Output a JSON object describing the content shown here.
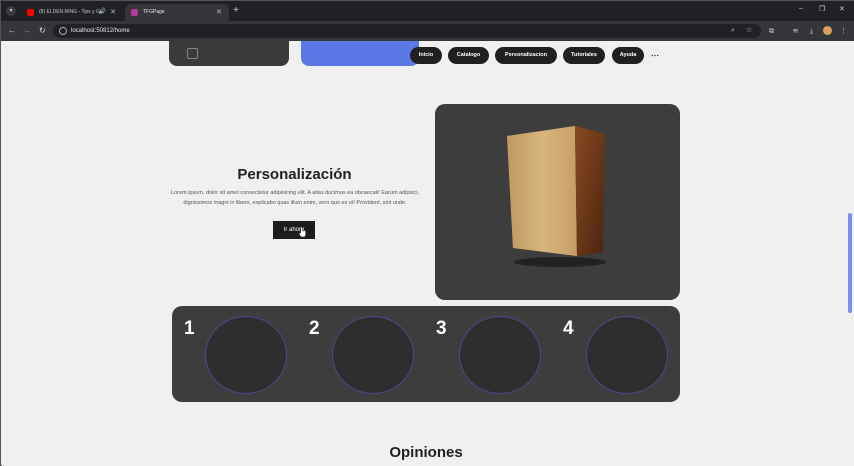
{
  "browser": {
    "tabs": [
      {
        "title": "(8) ELDEN RING - Tips y G...",
        "active": false,
        "favicon_color": "#ff0000",
        "audio": true
      },
      {
        "title": "TFGPage",
        "active": true,
        "favicon_color": "#b03a9a",
        "audio": false
      }
    ],
    "new_tab_label": "+",
    "url": "localhost:50812/home",
    "window_controls": {
      "minimize": "–",
      "restore": "❐",
      "close": "✕"
    },
    "nav": {
      "back": "←",
      "forward": "→",
      "reload": "↻"
    }
  },
  "nav_menu": {
    "items": [
      "Inicio",
      "Catalogo",
      "Personalizacion",
      "Tutoriales",
      "Ayuda"
    ],
    "more": "⋯"
  },
  "hero": {
    "title": "Personalización",
    "text": "Lorem ipsum, dolor sit amet consectetur adipisicing elit. A alias ducimus ea obcaecati! Earum adipisci, dignissimos magni in libero, explicabo quas illum enim, vero quo ex ut! Provident, sint unde.",
    "button": "Ir ahora"
  },
  "steps": [
    "1",
    "2",
    "3",
    "4"
  ],
  "opinions_title": "Opiniones",
  "colors": {
    "accent_blue": "#5b79e6",
    "card": "#3d3d3d",
    "background": "#f0f0f0"
  }
}
